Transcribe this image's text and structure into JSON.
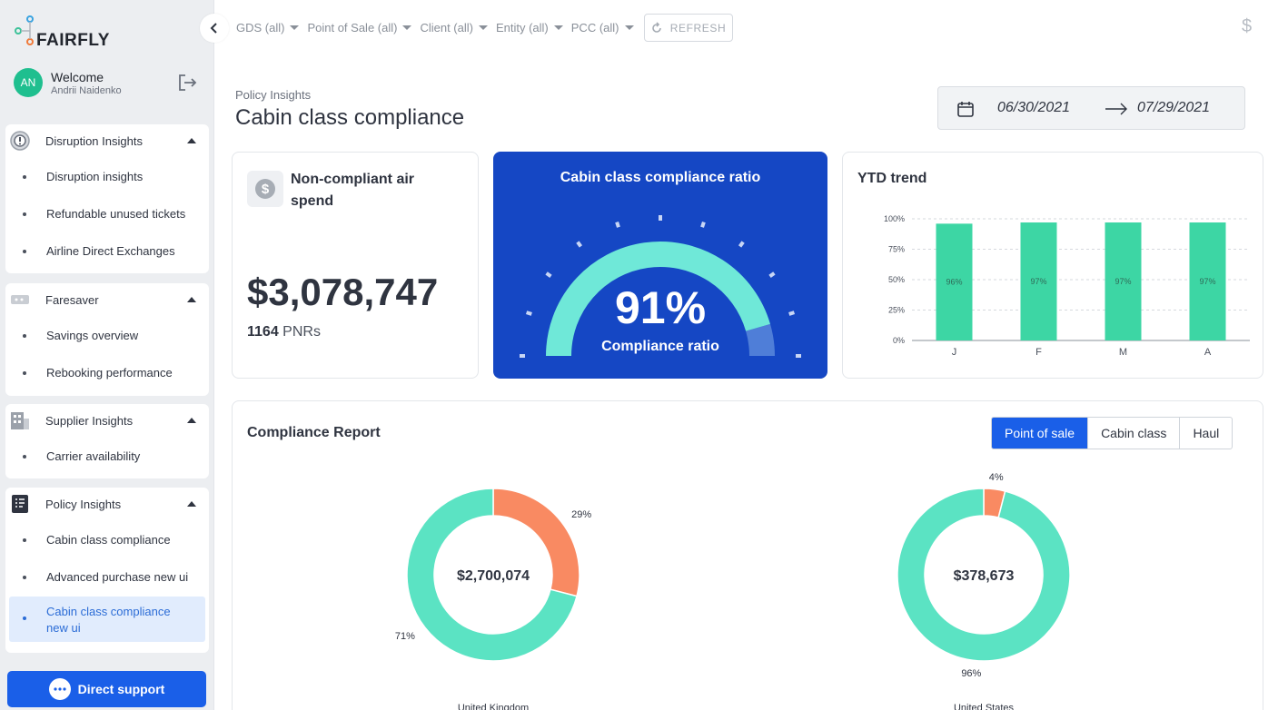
{
  "app": {
    "logo_text": "FAIRFLY"
  },
  "user": {
    "initials": "AN",
    "welcome": "Welcome",
    "name": "Andrii Naidenko"
  },
  "sidebar": {
    "sections": [
      {
        "title": "Disruption Insights",
        "items": [
          "Disruption insights",
          "Refundable unused tickets",
          "Airline Direct Exchanges"
        ]
      },
      {
        "title": "Faresaver",
        "items": [
          "Savings overview",
          "Rebooking performance"
        ]
      },
      {
        "title": "Supplier Insights",
        "items": [
          "Carrier availability"
        ]
      },
      {
        "title": "Policy Insights",
        "items": [
          "Cabin class compliance",
          "Advanced purchase new ui"
        ],
        "active_item": "Cabin class compliance new ui"
      }
    ],
    "support_label": "Direct support"
  },
  "filters": {
    "items": [
      "GDS (all)",
      "Point of Sale (all)",
      "Client (all)",
      "Entity (all)",
      "PCC (all)"
    ],
    "refresh_label": "REFRESH",
    "currency_symbol": "$"
  },
  "page": {
    "breadcrumb": "Policy Insights",
    "title": "Cabin class compliance",
    "date_from": "06/30/2021",
    "date_to": "07/29/2021"
  },
  "spend_card": {
    "title": "Non-compliant air spend",
    "amount": "$3,078,747",
    "pnr_count": "1164",
    "pnr_label": "PNRs"
  },
  "ratio_card": {
    "title": "Cabin class compliance ratio",
    "value": "91%",
    "value_fraction": 0.91,
    "label": "Compliance ratio"
  },
  "trend_card": {
    "title": "YTD trend"
  },
  "report": {
    "title": "Compliance Report",
    "tabs": [
      "Point of sale",
      "Cabin class",
      "Haul"
    ],
    "selected_tab": "Point of sale"
  },
  "colors": {
    "primary": "#1a5fe8",
    "gauge": "#6fe8d8",
    "teal": "#3dd6a4",
    "orange": "#f98a62",
    "donut_green": "#5be3c3"
  },
  "chart_data": [
    {
      "type": "bar",
      "title": "YTD trend",
      "categories": [
        "J",
        "F",
        "M",
        "A"
      ],
      "values": [
        96,
        97,
        97,
        97
      ],
      "data_labels": [
        "96%",
        "97%",
        "97%",
        "97%"
      ],
      "yticks": [
        "0%",
        "25%",
        "50%",
        "75%",
        "100%"
      ],
      "ylim": [
        0,
        100
      ],
      "grid": true
    },
    {
      "type": "pie",
      "title": "United Kingdom",
      "center_label": "$2,700,074",
      "slices": [
        {
          "label": "29%",
          "value": 29,
          "color": "#f98a62"
        },
        {
          "label": "71%",
          "value": 71,
          "color": "#5be3c3"
        }
      ]
    },
    {
      "type": "pie",
      "title": "United States",
      "center_label": "$378,673",
      "slices": [
        {
          "label": "4%",
          "value": 4,
          "color": "#f98a62"
        },
        {
          "label": "96%",
          "value": 96,
          "color": "#5be3c3"
        }
      ]
    }
  ]
}
